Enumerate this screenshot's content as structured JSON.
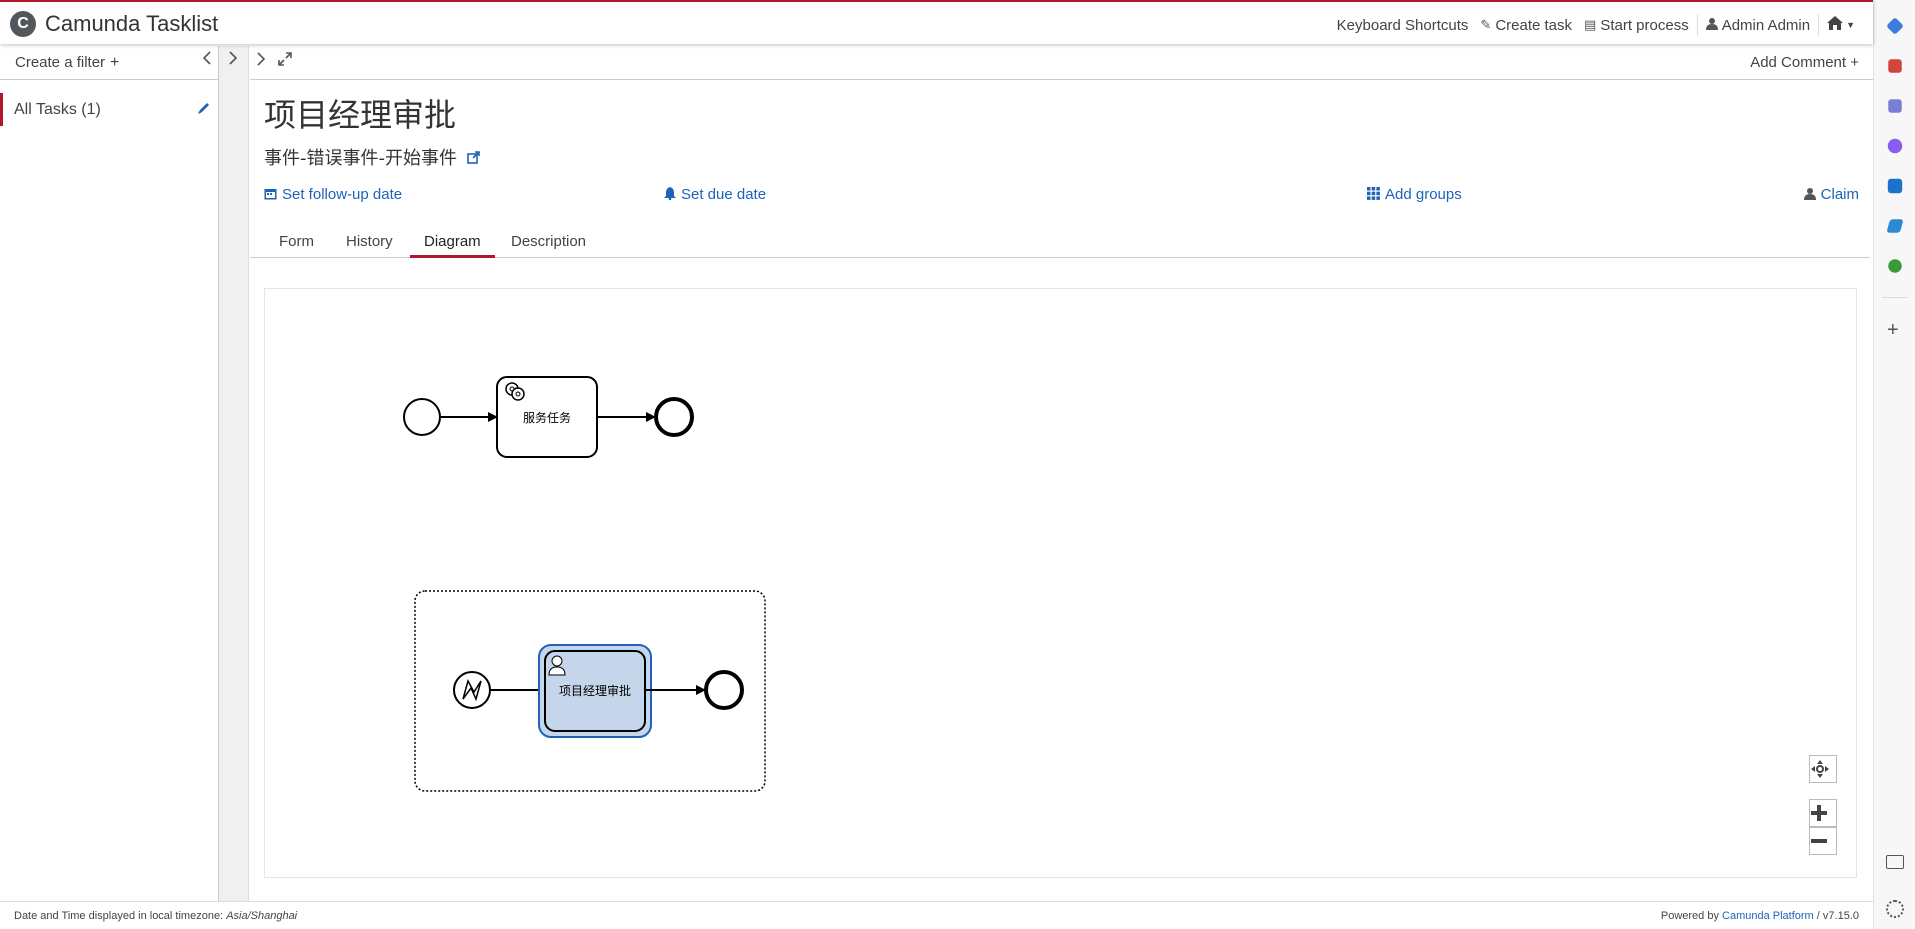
{
  "header": {
    "logo_text": "C",
    "app_title": "Camunda Tasklist",
    "nav": {
      "keyboard_shortcuts": "Keyboard Shortcuts",
      "create_task": "Create task",
      "start_process": "Start process",
      "user": "Admin Admin"
    }
  },
  "filters": {
    "create_filter": "Create a filter",
    "items": [
      {
        "label": "All Tasks (1)"
      }
    ]
  },
  "task": {
    "add_comment": "Add Comment",
    "title": "项目经理审批",
    "process_name": "事件-错误事件-开始事件",
    "actions": {
      "follow_up": "Set follow-up date",
      "due_date": "Set due date",
      "add_groups": "Add groups",
      "claim": "Claim"
    },
    "tabs": [
      {
        "label": "Form"
      },
      {
        "label": "History"
      },
      {
        "label": "Diagram",
        "active": true
      },
      {
        "label": "Description"
      }
    ]
  },
  "diagram": {
    "service_task_label": "服务任务",
    "user_task_label": "项目经理审批"
  },
  "footer": {
    "timezone_prefix": "Date and Time displayed in local timezone:",
    "timezone": "Asia/Shanghai",
    "powered_by": "Powered by",
    "platform": "Camunda Platform",
    "version": "/ v7.15.0"
  },
  "colors": {
    "accent": "#b5152b",
    "link": "#1d63b8",
    "selected_task_fill": "#c5d5ea",
    "selected_task_stroke": "#1d63b8"
  }
}
